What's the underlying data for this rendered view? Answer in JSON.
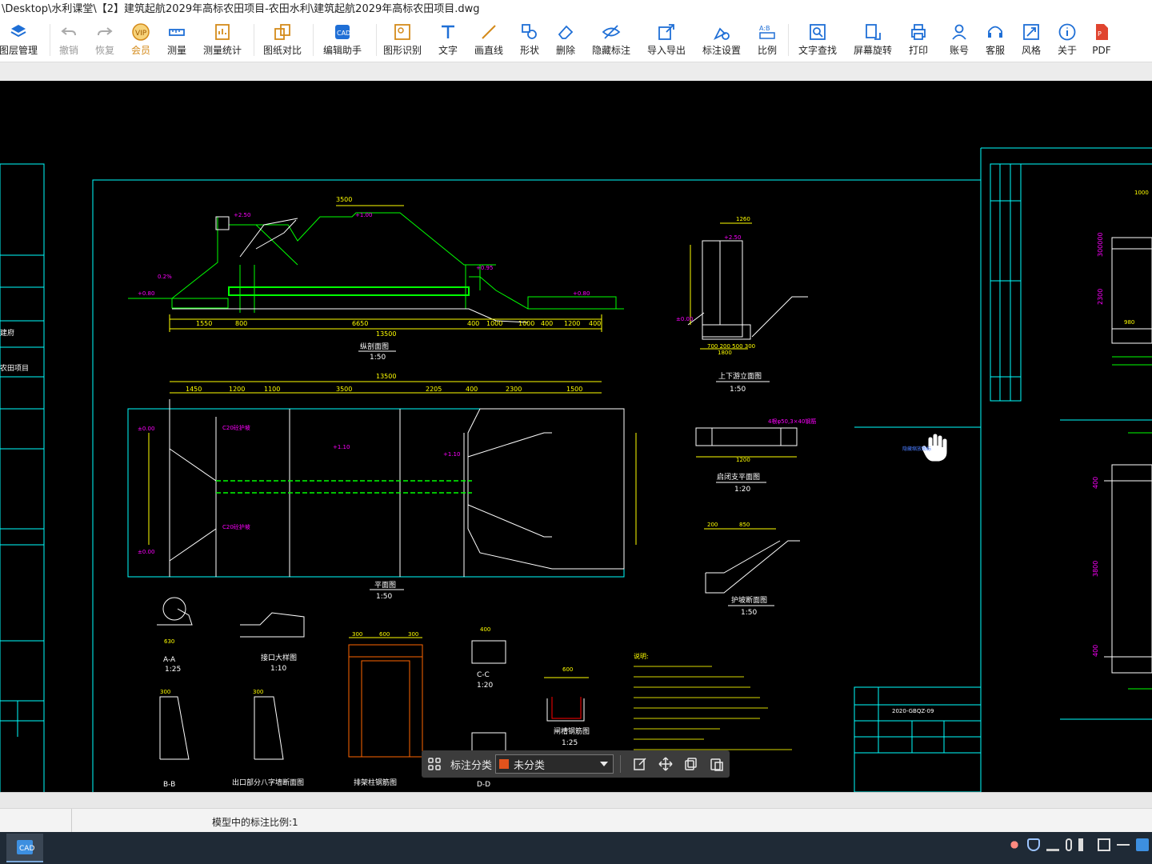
{
  "window": {
    "title": "\\Desktop\\水利课堂\\【2】建筑起航2029年高标农田项目-农田水利\\建筑起航2029年高标农田项目.dwg"
  },
  "toolbar": {
    "items": [
      {
        "label": "图层管理",
        "icon": "layers-icon"
      },
      {
        "label": "撤销",
        "icon": "undo-icon"
      },
      {
        "label": "恢复",
        "icon": "redo-icon"
      },
      {
        "label": "会员",
        "icon": "vip-icon"
      },
      {
        "label": "测量",
        "icon": "measure-icon"
      },
      {
        "label": "测量统计",
        "icon": "measure-stats-icon"
      },
      {
        "label": "图纸对比",
        "icon": "compare-icon"
      },
      {
        "label": "编辑助手",
        "icon": "edit-assistant-icon"
      },
      {
        "label": "图形识别",
        "icon": "shape-recognition-icon"
      },
      {
        "label": "文字",
        "icon": "text-icon"
      },
      {
        "label": "画直线",
        "icon": "line-icon"
      },
      {
        "label": "形状",
        "icon": "shape-icon"
      },
      {
        "label": "删除",
        "icon": "eraser-icon"
      },
      {
        "label": "隐藏标注",
        "icon": "hide-annotation-icon"
      },
      {
        "label": "导入导出",
        "icon": "import-export-icon"
      },
      {
        "label": "标注设置",
        "icon": "annotation-settings-icon"
      },
      {
        "label": "比例",
        "icon": "scale-icon"
      },
      {
        "label": "文字查找",
        "icon": "text-search-icon"
      },
      {
        "label": "屏幕旋转",
        "icon": "rotate-screen-icon"
      },
      {
        "label": "打印",
        "icon": "print-icon"
      },
      {
        "label": "账号",
        "icon": "account-icon"
      },
      {
        "label": "客服",
        "icon": "support-icon"
      },
      {
        "label": "风格",
        "icon": "style-icon"
      },
      {
        "label": "关于",
        "icon": "about-icon"
      },
      {
        "label": "PDF",
        "icon": "pdf-icon"
      }
    ]
  },
  "annotation_bar": {
    "label": "标注分类",
    "selected": "未分类",
    "swatch_color": "#e2531c"
  },
  "statusbar": {
    "scale_text": "模型中的标注比例:1"
  },
  "drawing": {
    "colors": {
      "frame": "#00ffff",
      "line": "#00ff00",
      "dim": "#ffff00",
      "label": "#ff00ff",
      "text": "#ffffff"
    },
    "views": [
      {
        "title": "纵剖面图",
        "scale": "1:50"
      },
      {
        "title": "平面图",
        "scale": "1:50"
      },
      {
        "title": "上下游立面图",
        "scale": "1:50"
      },
      {
        "title": "启闭支平面图",
        "scale": "1:20"
      },
      {
        "title": "护坡断面图",
        "scale": "1:50"
      },
      {
        "title": "A-A",
        "scale": "1:25"
      },
      {
        "title": "接口大样图",
        "scale": "1:10"
      },
      {
        "title": "B-B",
        "scale": ""
      },
      {
        "title": "出口部分八字墙断面图",
        "scale": ""
      },
      {
        "title": "排架柱钢筋图",
        "scale": ""
      },
      {
        "title": "C-C",
        "scale": "1:20"
      },
      {
        "title": "D-D",
        "scale": ""
      },
      {
        "title": "闸槽钢筋图",
        "scale": "1:25"
      }
    ],
    "dims_profile": [
      "3500",
      "13500",
      "1550",
      "800",
      "6650",
      "400",
      "1000",
      "1000",
      "400",
      "1200",
      "400"
    ],
    "dims_plan": [
      "13500",
      "1450",
      "1200",
      "1100",
      "3500",
      "2205",
      "400",
      "2300",
      "1500"
    ],
    "notes_title": "说明:",
    "drawing_no": "2020-GBQZ-09",
    "left_labels": [
      "建府",
      "农田项目"
    ]
  }
}
